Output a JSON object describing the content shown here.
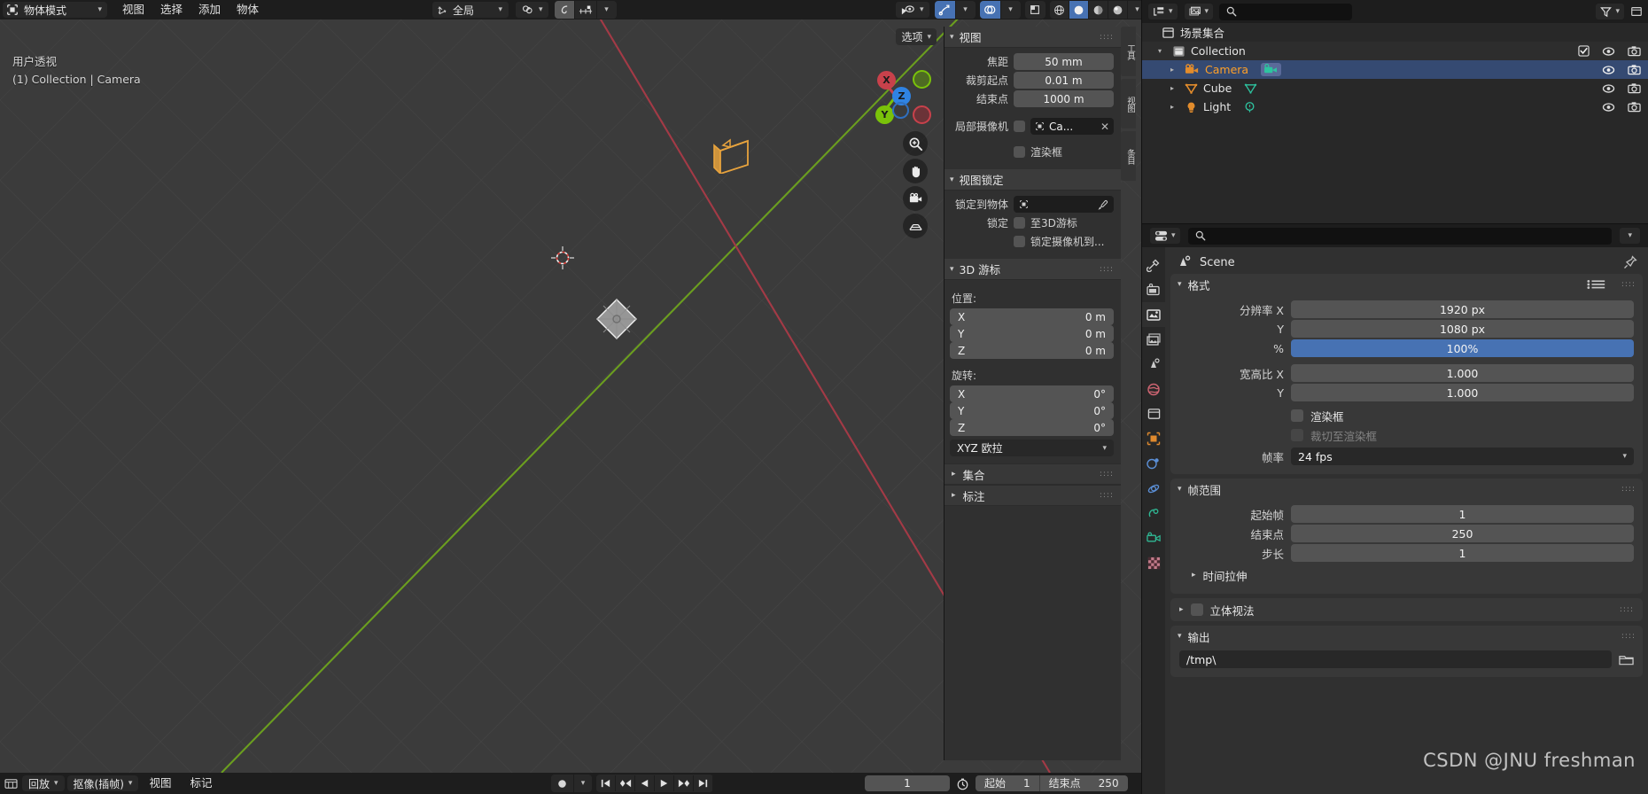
{
  "viewport_header": {
    "mode": "物体模式",
    "mode_icon": "object-mode-icon",
    "menus": [
      "视图",
      "选择",
      "添加",
      "物体"
    ],
    "transform_orientation": "全局",
    "orientation_icon": "orientation-axes-icon",
    "snap_magnet_icon": "magnet-icon",
    "snap_target_icon": "snap-increment-icon",
    "proportional_icon": "proportional-edit-icon",
    "proportional_falloff_icon": "falloff-curve-icon",
    "visibility_icon": "eye-dropdown-icon",
    "gizmo_icon": "gizmo-icon",
    "overlays_icon": "overlays-icon",
    "xray_icon": "xray-toggle-icon",
    "shading_modes": [
      "wireframe",
      "solid",
      "material-preview",
      "rendered"
    ],
    "shading_active": "solid",
    "shading_chevron_icon": "chevron-down-icon"
  },
  "tool_row": {
    "buttons": [
      "tweak-tool",
      "select-box",
      "select-circle",
      "select-lasso",
      "select-extend"
    ],
    "active_index": 0
  },
  "viewport": {
    "view_label": "用户透视",
    "scene_label": "(1) Collection | Camera",
    "options_label": "选项",
    "gizmo_axes": [
      "X",
      "Y",
      "Z"
    ],
    "nav_icons": [
      "zoom-icon",
      "pan-hand-icon",
      "camera-view-icon",
      "ortho-persp-icon"
    ]
  },
  "npanel": {
    "tabs": [
      "工具",
      "视图",
      "条目"
    ],
    "view_section": {
      "title": "视图",
      "focal_length_label": "焦距",
      "focal_length_value": "50 mm",
      "clip_start_label": "裁剪起点",
      "clip_start_value": "0.01 m",
      "clip_end_label": "结束点",
      "clip_end_value": "1000 m",
      "local_camera_label": "局部摄像机",
      "local_camera_value": "Ca...",
      "local_camera_clear_icon": "close-x-icon",
      "render_border_label": "渲染框"
    },
    "view_lock_section": {
      "title": "视图锁定",
      "lock_object_label": "锁定到物体",
      "lock_object_value": "",
      "eyedropper_icon": "eyedropper-icon",
      "lock_label": "锁定",
      "lock_cursor_label": "至3D游标",
      "lock_camera_label": "锁定摄像机到..."
    },
    "cursor_section": {
      "title": "3D 游标",
      "location_label": "位置:",
      "location": [
        {
          "axis": "X",
          "value": "0 m"
        },
        {
          "axis": "Y",
          "value": "0 m"
        },
        {
          "axis": "Z",
          "value": "0 m"
        }
      ],
      "rotation_label": "旋转:",
      "rotation": [
        {
          "axis": "X",
          "value": "0°"
        },
        {
          "axis": "Y",
          "value": "0°"
        },
        {
          "axis": "Z",
          "value": "0°"
        }
      ],
      "rotation_mode": "XYZ 欧拉"
    },
    "collections_section": "集合",
    "annotations_section": "标注"
  },
  "outliner": {
    "display_mode_icon": "outliner-display-icon",
    "filter_scene_icon": "scene-data-icon",
    "search_placeholder": "",
    "search_icon": "search-icon",
    "filter_icon": "funnel-filter-icon",
    "scene_collection": "场景集合",
    "rows": [
      {
        "name": "Collection",
        "icon": "collection-icon",
        "indent": 1,
        "expanded": true,
        "has_checkbox": true,
        "selected": false,
        "data_icon": ""
      },
      {
        "name": "Camera",
        "icon": "camera-object-icon",
        "indent": 2,
        "expanded": false,
        "has_checkbox": false,
        "selected": true,
        "data_icon": "camera-data-icon"
      },
      {
        "name": "Cube",
        "icon": "mesh-object-icon",
        "indent": 2,
        "expanded": false,
        "has_checkbox": false,
        "selected": false,
        "data_icon": "mesh-data-icon"
      },
      {
        "name": "Light",
        "icon": "light-object-icon",
        "indent": 2,
        "expanded": false,
        "has_checkbox": false,
        "selected": false,
        "data_icon": "light-data-icon"
      }
    ],
    "row_icons": [
      "eye-icon",
      "camera-render-icon"
    ]
  },
  "properties": {
    "editor_type_icon": "properties-editor-icon",
    "search_placeholder": "",
    "search_icon": "search-icon",
    "chevron_icon": "chevron-down-icon",
    "tabs": [
      {
        "name": "tool-tab",
        "glyph": "tool-wrench-icon",
        "active": false
      },
      {
        "name": "render-tab",
        "glyph": "render-camera-icon",
        "active": false
      },
      {
        "name": "output-tab",
        "glyph": "output-printer-icon",
        "active": true
      },
      {
        "name": "view-layer-tab",
        "glyph": "view-layer-images-icon",
        "active": false
      },
      {
        "name": "scene-tab",
        "glyph": "scene-cone-icon",
        "active": false
      },
      {
        "name": "world-tab",
        "glyph": "world-globe-icon",
        "active": false
      },
      {
        "name": "collection-tab",
        "glyph": "collection-box-icon",
        "active": false
      },
      {
        "name": "object-tab",
        "glyph": "object-square-icon",
        "active": false
      },
      {
        "name": "modifier-tab",
        "glyph": "modifier-wrench-icon",
        "active": false
      },
      {
        "name": "physics-tab",
        "glyph": "physics-orbit-icon",
        "active": false
      },
      {
        "name": "constraint-tab",
        "glyph": "constraint-icon",
        "active": false
      },
      {
        "name": "data-tab",
        "glyph": "camera-data-green-icon",
        "active": false
      },
      {
        "name": "material-tab",
        "glyph": "material-checker-icon",
        "active": false
      }
    ],
    "breadcrumb": "Scene",
    "breadcrumb_icon": "scene-icon",
    "pin_icon": "pin-icon",
    "format_panel": {
      "title": "格式",
      "preset_icon": "preset-list-icon",
      "rows": [
        {
          "label": "分辨率 X",
          "value": "1920 px",
          "accent": false
        },
        {
          "label": "Y",
          "value": "1080 px",
          "accent": false
        },
        {
          "label": "%",
          "value": "100%",
          "accent": true
        },
        {
          "label": "宽高比 X",
          "value": "1.000",
          "accent": false
        },
        {
          "label": "Y",
          "value": "1.000",
          "accent": false
        }
      ],
      "render_region_label": "渲染框",
      "crop_render_region_label": "裁切至渲染框",
      "frame_rate_label": "帧率",
      "frame_rate_value": "24 fps"
    },
    "frame_range_panel": {
      "title": "帧范围",
      "rows": [
        {
          "label": "起始帧",
          "value": "1"
        },
        {
          "label": "结束点",
          "value": "250"
        },
        {
          "label": "步长",
          "value": "1"
        }
      ],
      "time_stretching": "时间拉伸"
    },
    "stereoscopy_panel": "立体视法",
    "output_panel": {
      "title": "输出",
      "path_value": "/tmp\\",
      "folder_icon": "folder-icon"
    }
  },
  "timeline": {
    "editor_icon": "timeline-editor-icon",
    "playback_label": "回放",
    "keying_label": "抠像(插帧)",
    "menus": [
      "视图",
      "标记"
    ],
    "record_icon": "record-dot-icon",
    "transport": [
      "jump-start-icon",
      "prev-keyframe-icon",
      "play-reverse-icon",
      "play-icon",
      "next-keyframe-icon",
      "jump-end-icon"
    ],
    "current_frame": "1",
    "clock_icon": "clock-icon",
    "start_label": "起始",
    "start_value": "1",
    "end_label": "结束点",
    "end_value": "250"
  },
  "watermark": "CSDN @JNU freshman",
  "colors": {
    "accent_blue": "#4772b3",
    "selection_blue": "#354a72",
    "axis_x_red": "#c8414b",
    "axis_y_green": "#7ac20a",
    "axis_z_blue": "#2f83e3",
    "camera_orange": "#e8a33d",
    "outliner_selected_text": "#ffa028",
    "viewport_bg": "#3b3b3b",
    "panel_bg": "#303030",
    "header_bg": "#1d1d1d"
  }
}
